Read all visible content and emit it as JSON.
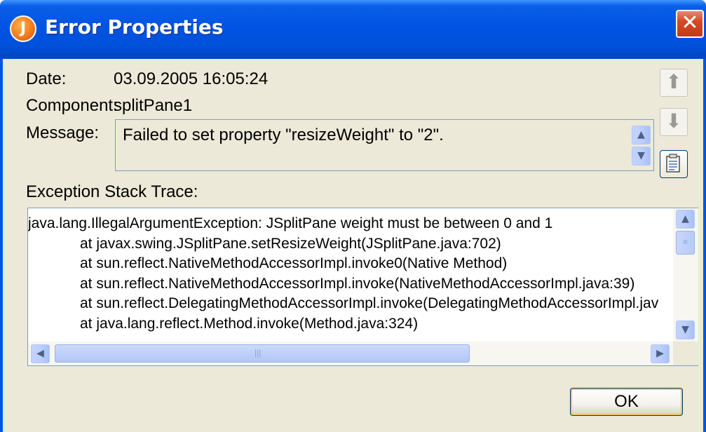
{
  "window": {
    "title": "Error Properties",
    "icon": "java-icon",
    "close_glyph": "✕"
  },
  "fields": {
    "date_label": "Date:",
    "date_value": "03.09.2005 16:05:24",
    "component_label": "Component:",
    "component_value": "splitPane1",
    "message_label": "Message:",
    "message_value": "Failed to set property \"resizeWeight\" to \"2\"."
  },
  "trace": {
    "label": "Exception Stack Trace:",
    "lines": [
      "java.lang.IllegalArgumentException: JSplitPane weight must be between 0 and 1",
      "at javax.swing.JSplitPane.setResizeWeight(JSplitPane.java:702)",
      "at sun.reflect.NativeMethodAccessorImpl.invoke0(Native Method)",
      "at sun.reflect.NativeMethodAccessorImpl.invoke(NativeMethodAccessorImpl.java:39)",
      "at sun.reflect.DelegatingMethodAccessorImpl.invoke(DelegatingMethodAccessorImpl.jav",
      "at java.lang.reflect.Method.invoke(Method.java:324)"
    ]
  },
  "buttons": {
    "previous_icon": "up-arrow-icon",
    "next_icon": "down-arrow-icon",
    "copy_icon": "clipboard-icon",
    "ok_label": "OK"
  },
  "colors": {
    "titlebar": "#0054e3",
    "dialog_background": "#ece9d8",
    "close_button": "#d54a25"
  }
}
